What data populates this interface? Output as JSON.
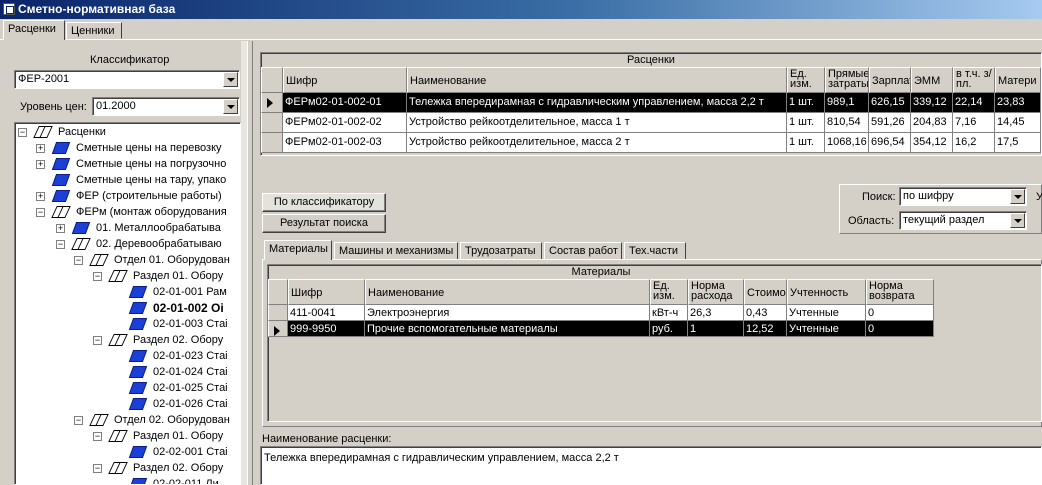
{
  "window": {
    "title": "Сметно-нормативная база"
  },
  "top_tabs": [
    {
      "label": "Расценки"
    },
    {
      "label": "Ценники"
    }
  ],
  "left": {
    "classifier_label": "Классификатор",
    "classifier_value": "ФЕР-2001",
    "price_level_label": "Уровень цен:",
    "price_level_value": "01.2000",
    "tree": [
      {
        "label": "Расценки"
      },
      {
        "label": "Сметные цены на перевозку"
      },
      {
        "label": "Сметные цены на погрузочно"
      },
      {
        "label": "Сметные цены на тару, упако"
      },
      {
        "label": "ФЕР (строительные работы)"
      },
      {
        "label": "ФЕРм (монтаж оборудования"
      },
      {
        "label": "01. Металлообрабатыва"
      },
      {
        "label": "02. Деревообрабатываю"
      },
      {
        "label": "Отдел 01. Оборудован"
      },
      {
        "label": "Раздел 01. Обору"
      },
      {
        "label": "02-01-001 Рам"
      },
      {
        "label": "02-01-002 Оі"
      },
      {
        "label": "02-01-003 Стаі"
      },
      {
        "label": "Раздел 02. Обору"
      },
      {
        "label": "02-01-023 Стаі"
      },
      {
        "label": "02-01-024 Стаі"
      },
      {
        "label": "02-01-025 Стаі"
      },
      {
        "label": "02-01-026 Стаі"
      },
      {
        "label": "Отдел 02. Оборудован"
      },
      {
        "label": "Раздел 01. Обору"
      },
      {
        "label": "02-02-001 Стаі"
      },
      {
        "label": "Раздел 02. Обору"
      },
      {
        "label": "02-02-011 Ли"
      }
    ]
  },
  "rates": {
    "caption": "Расценки",
    "headers": [
      "Шифр",
      "Наименование",
      "Ед. изм.",
      "Прямые затраты",
      "Зарплата",
      "ЭММ",
      "в т.ч. з/пл.",
      "Матери"
    ],
    "rows": [
      [
        "ФЕРм02-01-002-01",
        "Тележка впередирамная с гидравлическим управлением, масса 2,2 т",
        "1 шт.",
        "989,1",
        "626,15",
        "339,12",
        "22,14",
        "23,83"
      ],
      [
        "ФЕРм02-01-002-02",
        "Устройство рейкоотделительное, масса 1 т",
        "1 шт.",
        "810,54",
        "591,26",
        "204,83",
        "7,16",
        "14,45"
      ],
      [
        "ФЕРм02-01-002-03",
        "Устройство рейкоотделительное, масса 2 т",
        "1 шт.",
        "1068,16",
        "696,54",
        "354,12",
        "16,2",
        "17,5"
      ]
    ]
  },
  "buttons": {
    "by_classifier": "По классификатору",
    "search_result": "Результат поиска"
  },
  "search": {
    "label": "Поиск:",
    "value": "по шифру",
    "area_label": "Область:",
    "area_value": "текущий раздел",
    "extra": "У"
  },
  "detail_tabs": [
    {
      "label": "Материалы"
    },
    {
      "label": "Машины и механизмы"
    },
    {
      "label": "Трудозатраты"
    },
    {
      "label": "Состав работ"
    },
    {
      "label": "Тех.части"
    }
  ],
  "materials": {
    "caption": "Материалы",
    "headers": [
      "Шифр",
      "Наименование",
      "Ед. изм.",
      "Норма расхода",
      "Стоимо",
      "Учтенность",
      "Норма возврата"
    ],
    "rows": [
      [
        "411-0041",
        "Электроэнергия",
        "кВт-ч",
        "26,3",
        "0,43",
        "Учтенные",
        "0"
      ],
      [
        "999-9950",
        "Прочие вспомогательные материалы",
        "руб.",
        "1",
        "12,52",
        "Учтенные",
        "0"
      ]
    ]
  },
  "rate_name": {
    "label": "Наименование расценки:",
    "value": "Тележка впередирамная с гидравлическим управлением, масса 2,2 т"
  }
}
